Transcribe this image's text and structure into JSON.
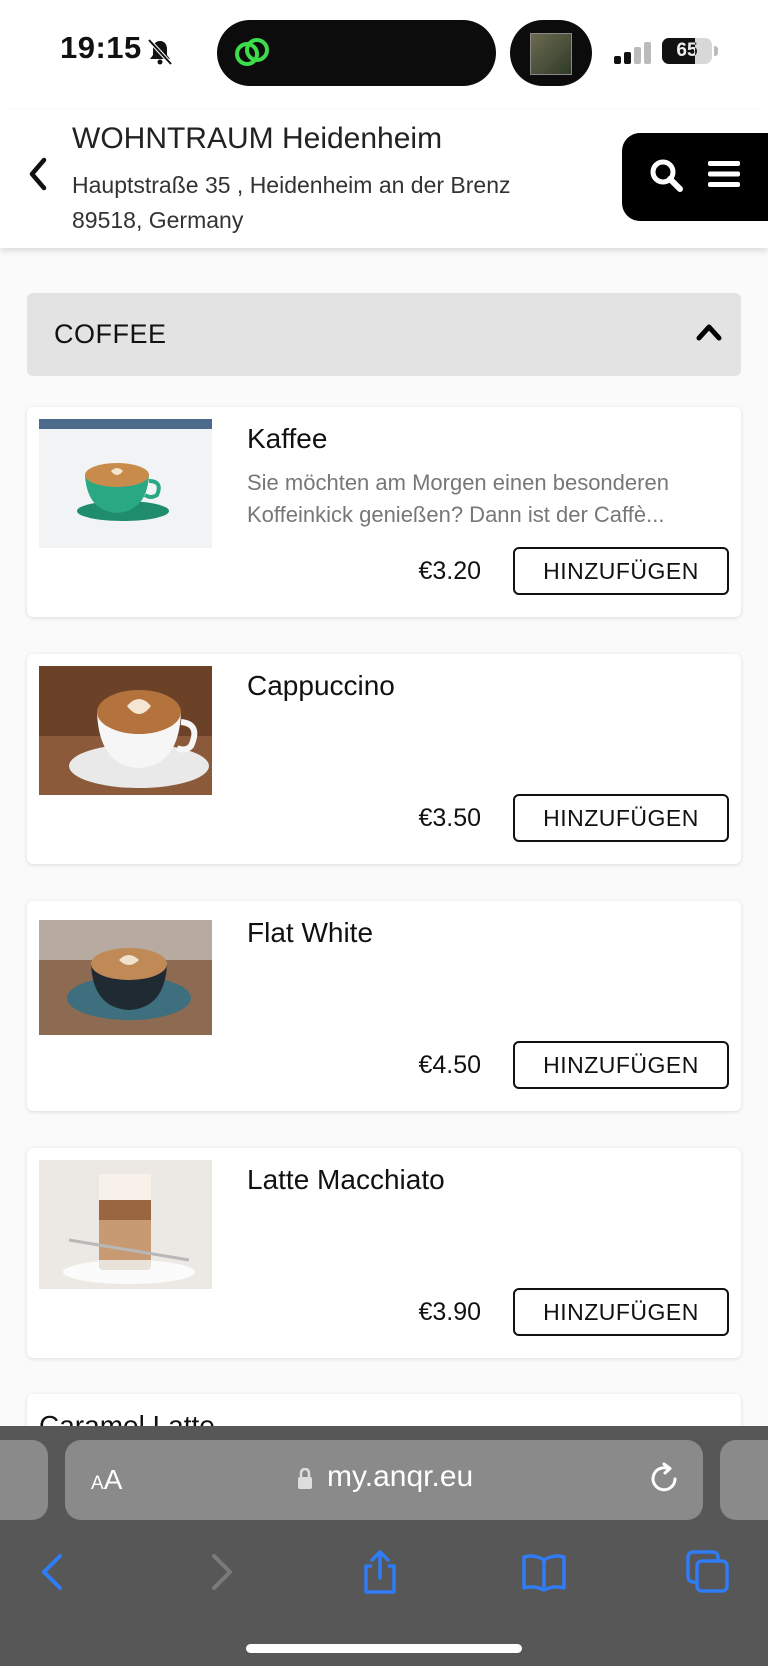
{
  "status_bar": {
    "time": "19:15",
    "battery": "65",
    "battery_level": 0.65
  },
  "header": {
    "store_name": "WOHNTRAUM Heidenheim",
    "address": "Hauptstraße 35 , Heidenheim an der Brenz 89518, Germany"
  },
  "category": {
    "label": "COFFEE"
  },
  "products": [
    {
      "name": "Kaffee",
      "description": "Sie möchten am Morgen einen besonderen Koffeinkick genießen? Dann ist der Caffè...",
      "price": "€3.20",
      "button": "HINZUFÜGEN"
    },
    {
      "name": "Cappuccino",
      "description": "",
      "price": "€3.50",
      "button": "HINZUFÜGEN"
    },
    {
      "name": "Flat White",
      "description": "",
      "price": "€4.50",
      "button": "HINZUFÜGEN"
    },
    {
      "name": "Latte Macchiato",
      "description": "",
      "price": "€3.90",
      "button": "HINZUFÜGEN"
    },
    {
      "name": "Caramel Latte"
    }
  ],
  "browser": {
    "aa_label": "AA",
    "url": "my.anqr.eu"
  },
  "icons": {
    "back": "chevron-left-icon",
    "search": "search-icon",
    "menu": "hamburger-menu-icon",
    "collapse": "chevron-up-icon",
    "share": "share-icon",
    "bookmarks": "book-icon",
    "tabs": "tabs-icon"
  },
  "colors": {
    "accent": "#2f7cf6",
    "header_tools": "#000000",
    "category_bg": "#e3e3e3",
    "toolbar_bg": "#575757"
  }
}
